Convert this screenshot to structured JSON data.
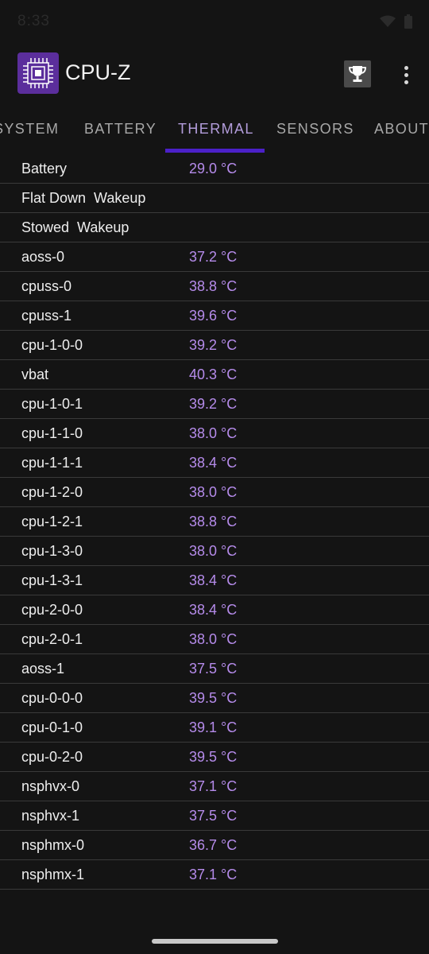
{
  "status_bar": {
    "time": "8:33"
  },
  "app": {
    "title": "CPU-Z"
  },
  "tabs": [
    {
      "label": "SYSTEM"
    },
    {
      "label": "BATTERY"
    },
    {
      "label": "THERMAL"
    },
    {
      "label": "SENSORS"
    },
    {
      "label": "ABOUT"
    }
  ],
  "active_tab": "THERMAL",
  "colors": {
    "accent": "#4b20c8",
    "value": "#b58bea",
    "background": "#141414"
  },
  "thermal": {
    "rows": [
      {
        "label": "Battery",
        "value": "29.0 °C"
      },
      {
        "label": "Flat Down  Wakeup",
        "value": ""
      },
      {
        "label": "Stowed  Wakeup",
        "value": ""
      },
      {
        "label": "aoss-0",
        "value": "37.2 °C"
      },
      {
        "label": "cpuss-0",
        "value": "38.8 °C"
      },
      {
        "label": "cpuss-1",
        "value": "39.6 °C"
      },
      {
        "label": "cpu-1-0-0",
        "value": "39.2 °C"
      },
      {
        "label": "vbat",
        "value": "40.3 °C"
      },
      {
        "label": "cpu-1-0-1",
        "value": "39.2 °C"
      },
      {
        "label": "cpu-1-1-0",
        "value": "38.0 °C"
      },
      {
        "label": "cpu-1-1-1",
        "value": "38.4 °C"
      },
      {
        "label": "cpu-1-2-0",
        "value": "38.0 °C"
      },
      {
        "label": "cpu-1-2-1",
        "value": "38.8 °C"
      },
      {
        "label": "cpu-1-3-0",
        "value": "38.0 °C"
      },
      {
        "label": "cpu-1-3-1",
        "value": "38.4 °C"
      },
      {
        "label": "cpu-2-0-0",
        "value": "38.4 °C"
      },
      {
        "label": "cpu-2-0-1",
        "value": "38.0 °C"
      },
      {
        "label": "aoss-1",
        "value": "37.5 °C"
      },
      {
        "label": "cpu-0-0-0",
        "value": "39.5 °C"
      },
      {
        "label": "cpu-0-1-0",
        "value": "39.1 °C"
      },
      {
        "label": "cpu-0-2-0",
        "value": "39.5 °C"
      },
      {
        "label": "nsphvx-0",
        "value": "37.1 °C"
      },
      {
        "label": "nsphvx-1",
        "value": "37.5 °C"
      },
      {
        "label": "nsphmx-0",
        "value": "36.7 °C"
      },
      {
        "label": "nsphmx-1",
        "value": "37.1 °C"
      }
    ]
  }
}
